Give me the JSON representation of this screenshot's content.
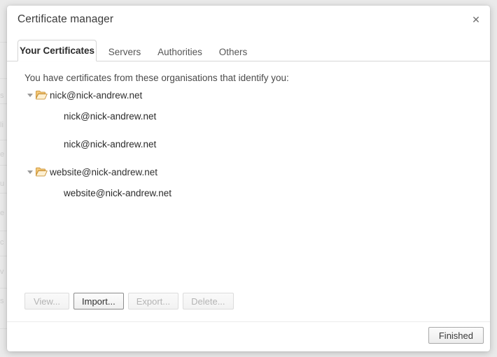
{
  "dialog": {
    "title": "Certificate manager",
    "close_label": "✕"
  },
  "tabs": [
    {
      "label": "Your Certificates",
      "active": true
    },
    {
      "label": "Servers",
      "active": false
    },
    {
      "label": "Authorities",
      "active": false
    },
    {
      "label": "Others",
      "active": false
    }
  ],
  "body": {
    "description": "You have certificates from these organisations that identify you:",
    "tree": [
      {
        "label": "nick@nick-andrew.net",
        "expanded": true,
        "children": [
          {
            "label": "nick@nick-andrew.net"
          },
          {
            "label": "nick@nick-andrew.net"
          }
        ]
      },
      {
        "label": "website@nick-andrew.net",
        "expanded": true,
        "children": [
          {
            "label": "website@nick-andrew.net"
          }
        ]
      }
    ]
  },
  "actions": [
    {
      "label": "View...",
      "state": "disabled"
    },
    {
      "label": "Import...",
      "state": "focused"
    },
    {
      "label": "Export...",
      "state": "disabled"
    },
    {
      "label": "Delete...",
      "state": "disabled"
    }
  ],
  "footer": {
    "finished_label": "Finished"
  },
  "backdrop": {
    "ghost_fragments": [
      "s",
      "li",
      "e",
      "u",
      "e",
      "c",
      "v",
      "s"
    ]
  },
  "colors": {
    "page_background": "#e9e9e9",
    "dialog_background": "#ffffff",
    "folder_fill": "#f5c97a",
    "folder_outline": "#c99338",
    "title_text": "#3b3b3b",
    "body_text": "#4a4a4a",
    "tab_border": "#d6d6d6",
    "disabled_text": "#b4b4b4"
  }
}
